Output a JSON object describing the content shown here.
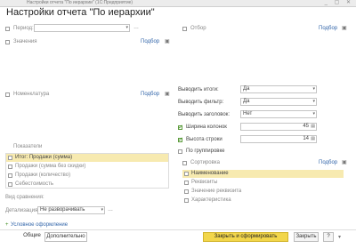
{
  "window": {
    "title": "Настройки отчета \"По иерархии\" (1С:Предприятие)",
    "controls": "_ ▢ ✕"
  },
  "page": {
    "heading": "Настройки отчета \"По иерархии\""
  },
  "left": {
    "period_label": "Период:",
    "period_value": "",
    "details_label": "Значения",
    "details_link": "Подбор",
    "rows_label": "Номенклатура",
    "rows_link": "Подбор",
    "indicators_label": "Показатели",
    "indicators": [
      {
        "label": "Итог: Продажи (сумма)",
        "checked": false,
        "selected": true
      },
      {
        "label": "Продажи (сумма без скидки)",
        "checked": false,
        "selected": false
      },
      {
        "label": "Продажи (количество)",
        "checked": false,
        "selected": false
      },
      {
        "label": "Себестоимость",
        "checked": false,
        "selected": false
      }
    ],
    "extra_label": "Вид сравнения:",
    "detail_label": "Детализация:",
    "detail_value": "Не разворачивать",
    "conditions_link": "Условное оформление"
  },
  "right": {
    "filter_label": "Отбор",
    "filter_link": "Подбор",
    "output_title_label": "Выводить итоги:",
    "output_title_value": "Да",
    "output_filter_label": "Выводить фильтр:",
    "output_filter_value": "Да",
    "header_label": "Выводить заголовок:",
    "header_value": "Нет",
    "width_label": "Ширина колонок",
    "width_checked": true,
    "width_value": "45",
    "height_label": "Высота строки",
    "height_checked": true,
    "height_value": "14",
    "by_group_label": "По группировке",
    "by_group_checked": false,
    "sort_label": "Сортировка",
    "sort_link": "Подбор",
    "sort_items": [
      {
        "label": "Наименование",
        "selected": true
      },
      {
        "label": "Реквизиты",
        "selected": false
      },
      {
        "label": "Значение реквизита",
        "selected": false
      },
      {
        "label": "Характеристика",
        "selected": false
      }
    ]
  },
  "footer": {
    "tab_left": "Общие",
    "tab_active": "Дополнительно",
    "apply_button": "Закрыть и сформировать",
    "close_button": "Закрыть",
    "help_button": "?"
  }
}
